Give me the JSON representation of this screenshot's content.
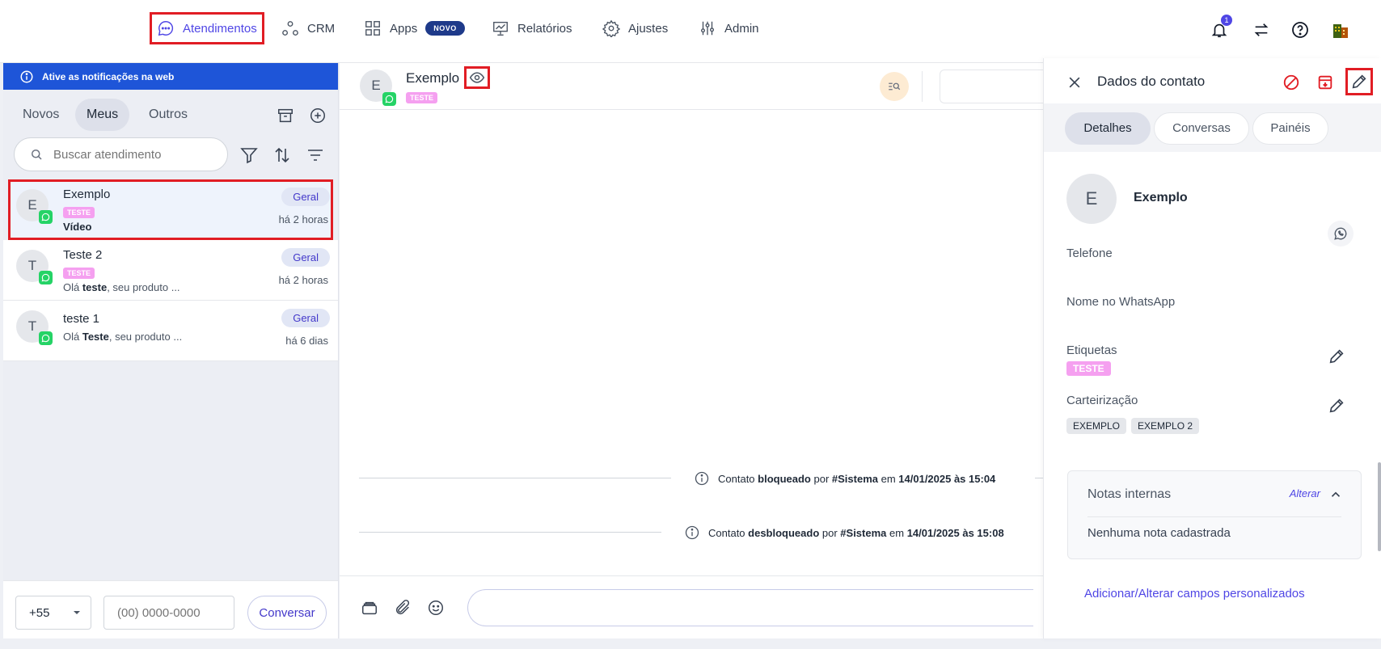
{
  "nav": {
    "items": [
      {
        "label": "Atendimentos"
      },
      {
        "label": "CRM"
      },
      {
        "label": "Apps",
        "badge": "NOVO"
      },
      {
        "label": "Relatórios"
      },
      {
        "label": "Ajustes"
      },
      {
        "label": "Admin"
      }
    ],
    "notification_count": "1",
    "icons": [
      "bell-icon",
      "transfer-icon",
      "help-icon",
      "building-icon"
    ]
  },
  "left": {
    "banner": "Ative as notificações na web",
    "tabs": [
      "Novos",
      "Meus",
      "Outros"
    ],
    "active_tab": "Meus",
    "search_placeholder": "Buscar atendimento",
    "conversations": [
      {
        "avatar": "E",
        "name": "Exemplo",
        "tag": "TESTE",
        "preview_bold": "Vídeo",
        "preview_rest": "",
        "queue": "Geral",
        "time": "há 2 horas",
        "selected": true
      },
      {
        "avatar": "T",
        "name": "Teste 2",
        "tag": "TESTE",
        "preview_prefix": "Olá ",
        "preview_bold": "teste",
        "preview_rest": ", seu produto ...",
        "queue": "Geral",
        "time": "há 2 horas"
      },
      {
        "avatar": "T",
        "name": "teste 1",
        "preview_prefix": "Olá ",
        "preview_bold": "Teste",
        "preview_rest": ", seu produto ...",
        "queue": "Geral",
        "time": "há 6 dias"
      }
    ],
    "footer": {
      "ddi": "+55",
      "phone_placeholder": "(00) 0000-0000",
      "button": "Conversar"
    }
  },
  "chat": {
    "avatar": "E",
    "name": "Exemplo",
    "tag": "TESTE",
    "system_messages": [
      {
        "prefix": "Contato ",
        "action": "bloqueado",
        "by": " por ",
        "actor": "#Sistema",
        "at": " em ",
        "datetime": "14/01/2025 às 15:04"
      },
      {
        "prefix": "Contato ",
        "action": "desbloqueado",
        "by": " por ",
        "actor": "#Sistema",
        "at": " em ",
        "datetime": "14/01/2025 às 15:08"
      }
    ]
  },
  "right": {
    "title": "Dados do contato",
    "tabs": [
      "Detalhes",
      "Conversas",
      "Painéis"
    ],
    "active_tab": "Detalhes",
    "avatar": "E",
    "name": "Exemplo",
    "labels": {
      "telefone": "Telefone",
      "nome_whatsapp": "Nome no WhatsApp",
      "etiquetas": "Etiquetas",
      "carteirizacao": "Carteirização"
    },
    "etiqueta": "TESTE",
    "carteiras": [
      "EXEMPLO",
      "EXEMPLO 2"
    ],
    "notes": {
      "title": "Notas internas",
      "action": "Alterar",
      "empty": "Nenhuma nota cadastrada"
    },
    "custom_fields_link": "Adicionar/Alterar campos personalizados"
  },
  "colors": {
    "accent": "#4f46e5",
    "banner": "#1e55d8",
    "highlight": "#e11d24",
    "tag": "#f5a0f0",
    "whatsapp": "#25d366"
  }
}
